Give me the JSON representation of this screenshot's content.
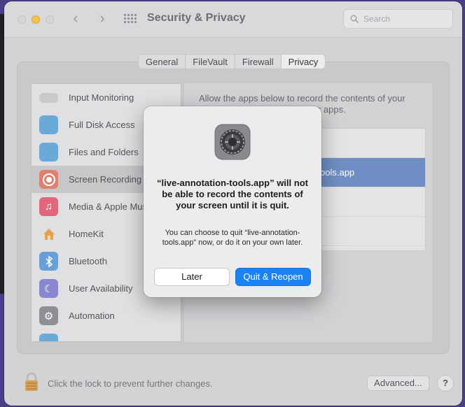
{
  "window": {
    "title": "Security & Privacy",
    "search_placeholder": "Search"
  },
  "tabs": [
    {
      "label": "General",
      "active": false
    },
    {
      "label": "FileVault",
      "active": false
    },
    {
      "label": "Firewall",
      "active": false
    },
    {
      "label": "Privacy",
      "active": true
    }
  ],
  "sidebar": {
    "items": [
      {
        "label": "Input Monitoring",
        "icon": "keyboard-icon"
      },
      {
        "label": "Full Disk Access",
        "icon": "folder-icon"
      },
      {
        "label": "Files and Folders",
        "icon": "folder-icon"
      },
      {
        "label": "Screen Recording",
        "icon": "screen-recording-icon",
        "selected": true
      },
      {
        "label": "Media & Apple Mus",
        "icon": "music-note-icon"
      },
      {
        "label": "HomeKit",
        "icon": "home-icon"
      },
      {
        "label": "Bluetooth",
        "icon": "bluetooth-icon"
      },
      {
        "label": "User Availability",
        "icon": "moon-icon"
      },
      {
        "label": "Automation",
        "icon": "gear-icon"
      }
    ]
  },
  "right_pane": {
    "description_line1": "Allow the apps below to record the contents of your",
    "description_line2": "r apps.",
    "selected_app_fragment": "ools.app"
  },
  "footer": {
    "lock_text": "Click the lock to prevent further changes.",
    "advanced_label": "Advanced...",
    "help_label": "?"
  },
  "dialog": {
    "title": "“live-annotation-tools.app” will not be able to record the contents of your screen until it is quit.",
    "message": "You can choose to quit “live-annotation-tools.app” now, or do it on your own later.",
    "later_label": "Later",
    "quit_label": "Quit & Reopen"
  },
  "colors": {
    "accent": "#1a82f4",
    "minimize": "#f1c44a",
    "selection": "#6f8fc4"
  }
}
